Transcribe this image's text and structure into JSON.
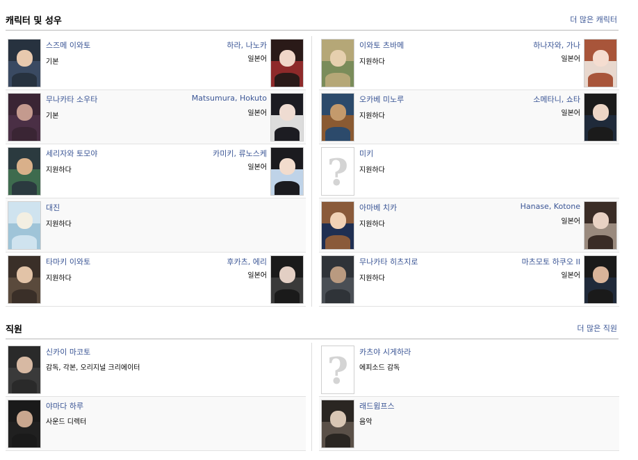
{
  "characters_section": {
    "title": "캐릭터 및 성우",
    "more_link": "더 많은 캐릭터"
  },
  "characters_left": [
    {
      "name": "스즈메 이와토",
      "role": "기본",
      "va_name": "하라, 나노카",
      "va_lang": "일본어",
      "has_char_image": true,
      "has_va_image": true,
      "char_colors": [
        "#27323f",
        "#e8c9ae",
        "#3a4a62"
      ],
      "va_colors": [
        "#2a1a18",
        "#f0d6c8",
        "#8e2a2a"
      ]
    },
    {
      "name": "무나카타 소우타",
      "role": "기본",
      "va_name": "Matsumura, Hokuto",
      "va_lang": "일본어",
      "has_char_image": true,
      "has_va_image": true,
      "char_colors": [
        "#3a2534",
        "#c49a8e",
        "#4a2f45"
      ],
      "va_colors": [
        "#1c1c22",
        "#efdcd2",
        "#dcdcdc"
      ]
    },
    {
      "name": "세리자와 토모야",
      "role": "지원하다",
      "va_name": "카미키, 류노스케",
      "va_lang": "일본어",
      "has_char_image": true,
      "has_va_image": true,
      "char_colors": [
        "#2b3a3f",
        "#d9b08a",
        "#3e6b4e"
      ],
      "va_colors": [
        "#1b1b1f",
        "#f2dccd",
        "#bfd3e8"
      ]
    },
    {
      "name": "대진",
      "role": "지원하다",
      "va_name": "",
      "va_lang": "",
      "has_char_image": true,
      "has_va_image": false,
      "char_colors": [
        "#cfe3ef",
        "#f3efe2",
        "#9fc4d8"
      ],
      "va_colors": []
    },
    {
      "name": "타마키 이와토",
      "role": "지원하다",
      "va_name": "후카츠, 에리",
      "va_lang": "일본어",
      "has_char_image": true,
      "has_va_image": true,
      "char_colors": [
        "#3a2f28",
        "#e2c3a7",
        "#5a4a3c"
      ],
      "va_colors": [
        "#1a1a1a",
        "#e3cfc4",
        "#3a3a3a"
      ]
    }
  ],
  "characters_right": [
    {
      "name": "이와토 츠바메",
      "role": "지원하다",
      "va_name": "하나자와, 가나",
      "va_lang": "일본어",
      "has_char_image": true,
      "has_va_image": true,
      "char_colors": [
        "#b5a777",
        "#e6cfae",
        "#7a8c5a"
      ],
      "va_colors": [
        "#a8553a",
        "#f5ddd0",
        "#e8d8ce"
      ]
    },
    {
      "name": "오카베 미노루",
      "role": "지원하다",
      "va_name": "소메타니, 쇼타",
      "va_lang": "일본어",
      "has_char_image": true,
      "has_va_image": true,
      "char_colors": [
        "#2c4a6b",
        "#c49a6c",
        "#8a5a32"
      ],
      "va_colors": [
        "#1b1b1b",
        "#edd6c6",
        "#1f2a3a"
      ]
    },
    {
      "name": "미키",
      "role": "지원하다",
      "va_name": "",
      "va_lang": "",
      "has_char_image": false,
      "has_va_image": false,
      "char_colors": [],
      "va_colors": []
    },
    {
      "name": "아마베 치카",
      "role": "지원하다",
      "va_name": "Hanase, Kotone",
      "va_lang": "일본어",
      "has_char_image": true,
      "has_va_image": true,
      "char_colors": [
        "#8a5a3a",
        "#f1d2b6",
        "#1f2f52"
      ],
      "va_colors": [
        "#3a2c26",
        "#e9d2c4",
        "#9a8a7e"
      ]
    },
    {
      "name": "무나카타 히츠지로",
      "role": "지원하다",
      "va_name": "마츠모토 하쿠오 II",
      "va_lang": "일본어",
      "has_char_image": true,
      "has_va_image": true,
      "char_colors": [
        "#2f3338",
        "#b99a80",
        "#4a4f55"
      ],
      "va_colors": [
        "#1a1a1a",
        "#d9b49a",
        "#202a3a"
      ]
    }
  ],
  "staff_section": {
    "title": "직원",
    "more_link": "더 많은 직원"
  },
  "staff_left": [
    {
      "name": "신카이 마코토",
      "role": "감독, 각본, 오리지널 크리에이터",
      "has_image": true,
      "colors": [
        "#2a2a2a",
        "#d7b9a3",
        "#3a3a3a"
      ]
    },
    {
      "name": "야마다 하루",
      "role": "사운드 디렉터",
      "has_image": true,
      "colors": [
        "#1a1a1a",
        "#c9a78f",
        "#202020"
      ]
    }
  ],
  "staff_right": [
    {
      "name": "카츠야 시게하라",
      "role": "에피소드 감독",
      "has_image": false,
      "colors": []
    },
    {
      "name": "래드윔프스",
      "role": "음악",
      "has_image": true,
      "colors": [
        "#2a2622",
        "#d8c6b4",
        "#5a5048"
      ]
    }
  ]
}
